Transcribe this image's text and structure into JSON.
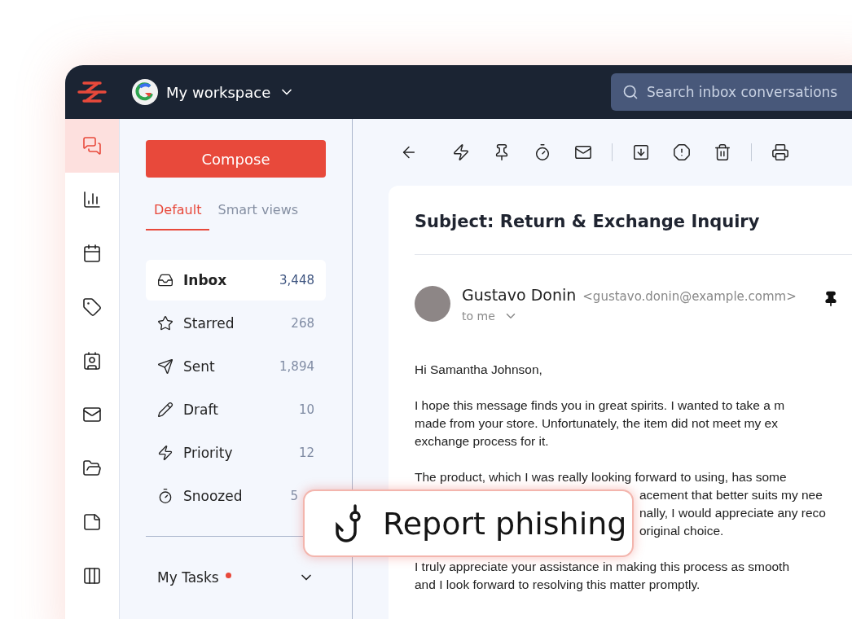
{
  "header": {
    "workspace": "My workspace",
    "search": {
      "placeholder": "Search inbox conversations"
    }
  },
  "rail": [
    {
      "selected": true
    },
    {
      "selected": false
    },
    {
      "selected": false
    },
    {
      "selected": false
    },
    {
      "selected": false
    },
    {
      "selected": false
    },
    {
      "selected": false
    },
    {
      "selected": false
    },
    {
      "selected": false
    }
  ],
  "compose": "Compose",
  "tabs": [
    {
      "label": "Default",
      "selected": true
    },
    {
      "label": "Smart views",
      "selected": false
    }
  ],
  "folders": [
    {
      "label": "Inbox",
      "count": "3,448",
      "selected": true
    },
    {
      "label": "Starred",
      "count": "268",
      "selected": false
    },
    {
      "label": "Sent",
      "count": "1,894",
      "selected": false
    },
    {
      "label": "Draft",
      "count": "10",
      "selected": false
    },
    {
      "label": "Priority",
      "count": "12",
      "selected": false
    },
    {
      "label": "Snoozed",
      "count": "5",
      "selected": false
    }
  ],
  "tasks": {
    "label": "My Tasks",
    "unread": true
  },
  "message": {
    "subject": "Subject: Return & Exchange Inquiry",
    "sender": "Gustavo Donin",
    "email": "<gustavo.donin@example.comm>",
    "recipient": "to me",
    "pinned": true,
    "greeting": "Hi Samantha Johnson,",
    "paragraphs": [
      {
        "lines": [
          "I hope this message finds you in great spirits. I wanted to take a m",
          "made from your store. Unfortunately, the item did not meet my ex",
          "exchange process for it."
        ]
      },
      {
        "lines": [
          "The product, which I was really looking forward to using, has some"
        ],
        "covered_lines": [
          "acement that better suits my nee",
          "nally, I would appreciate any reco",
          "original choice."
        ]
      },
      {
        "lines": [
          "I truly appreciate your assistance in making this process as smooth",
          "and I look forward to resolving this matter promptly."
        ]
      }
    ]
  },
  "popup": {
    "label": "Report phishing"
  }
}
